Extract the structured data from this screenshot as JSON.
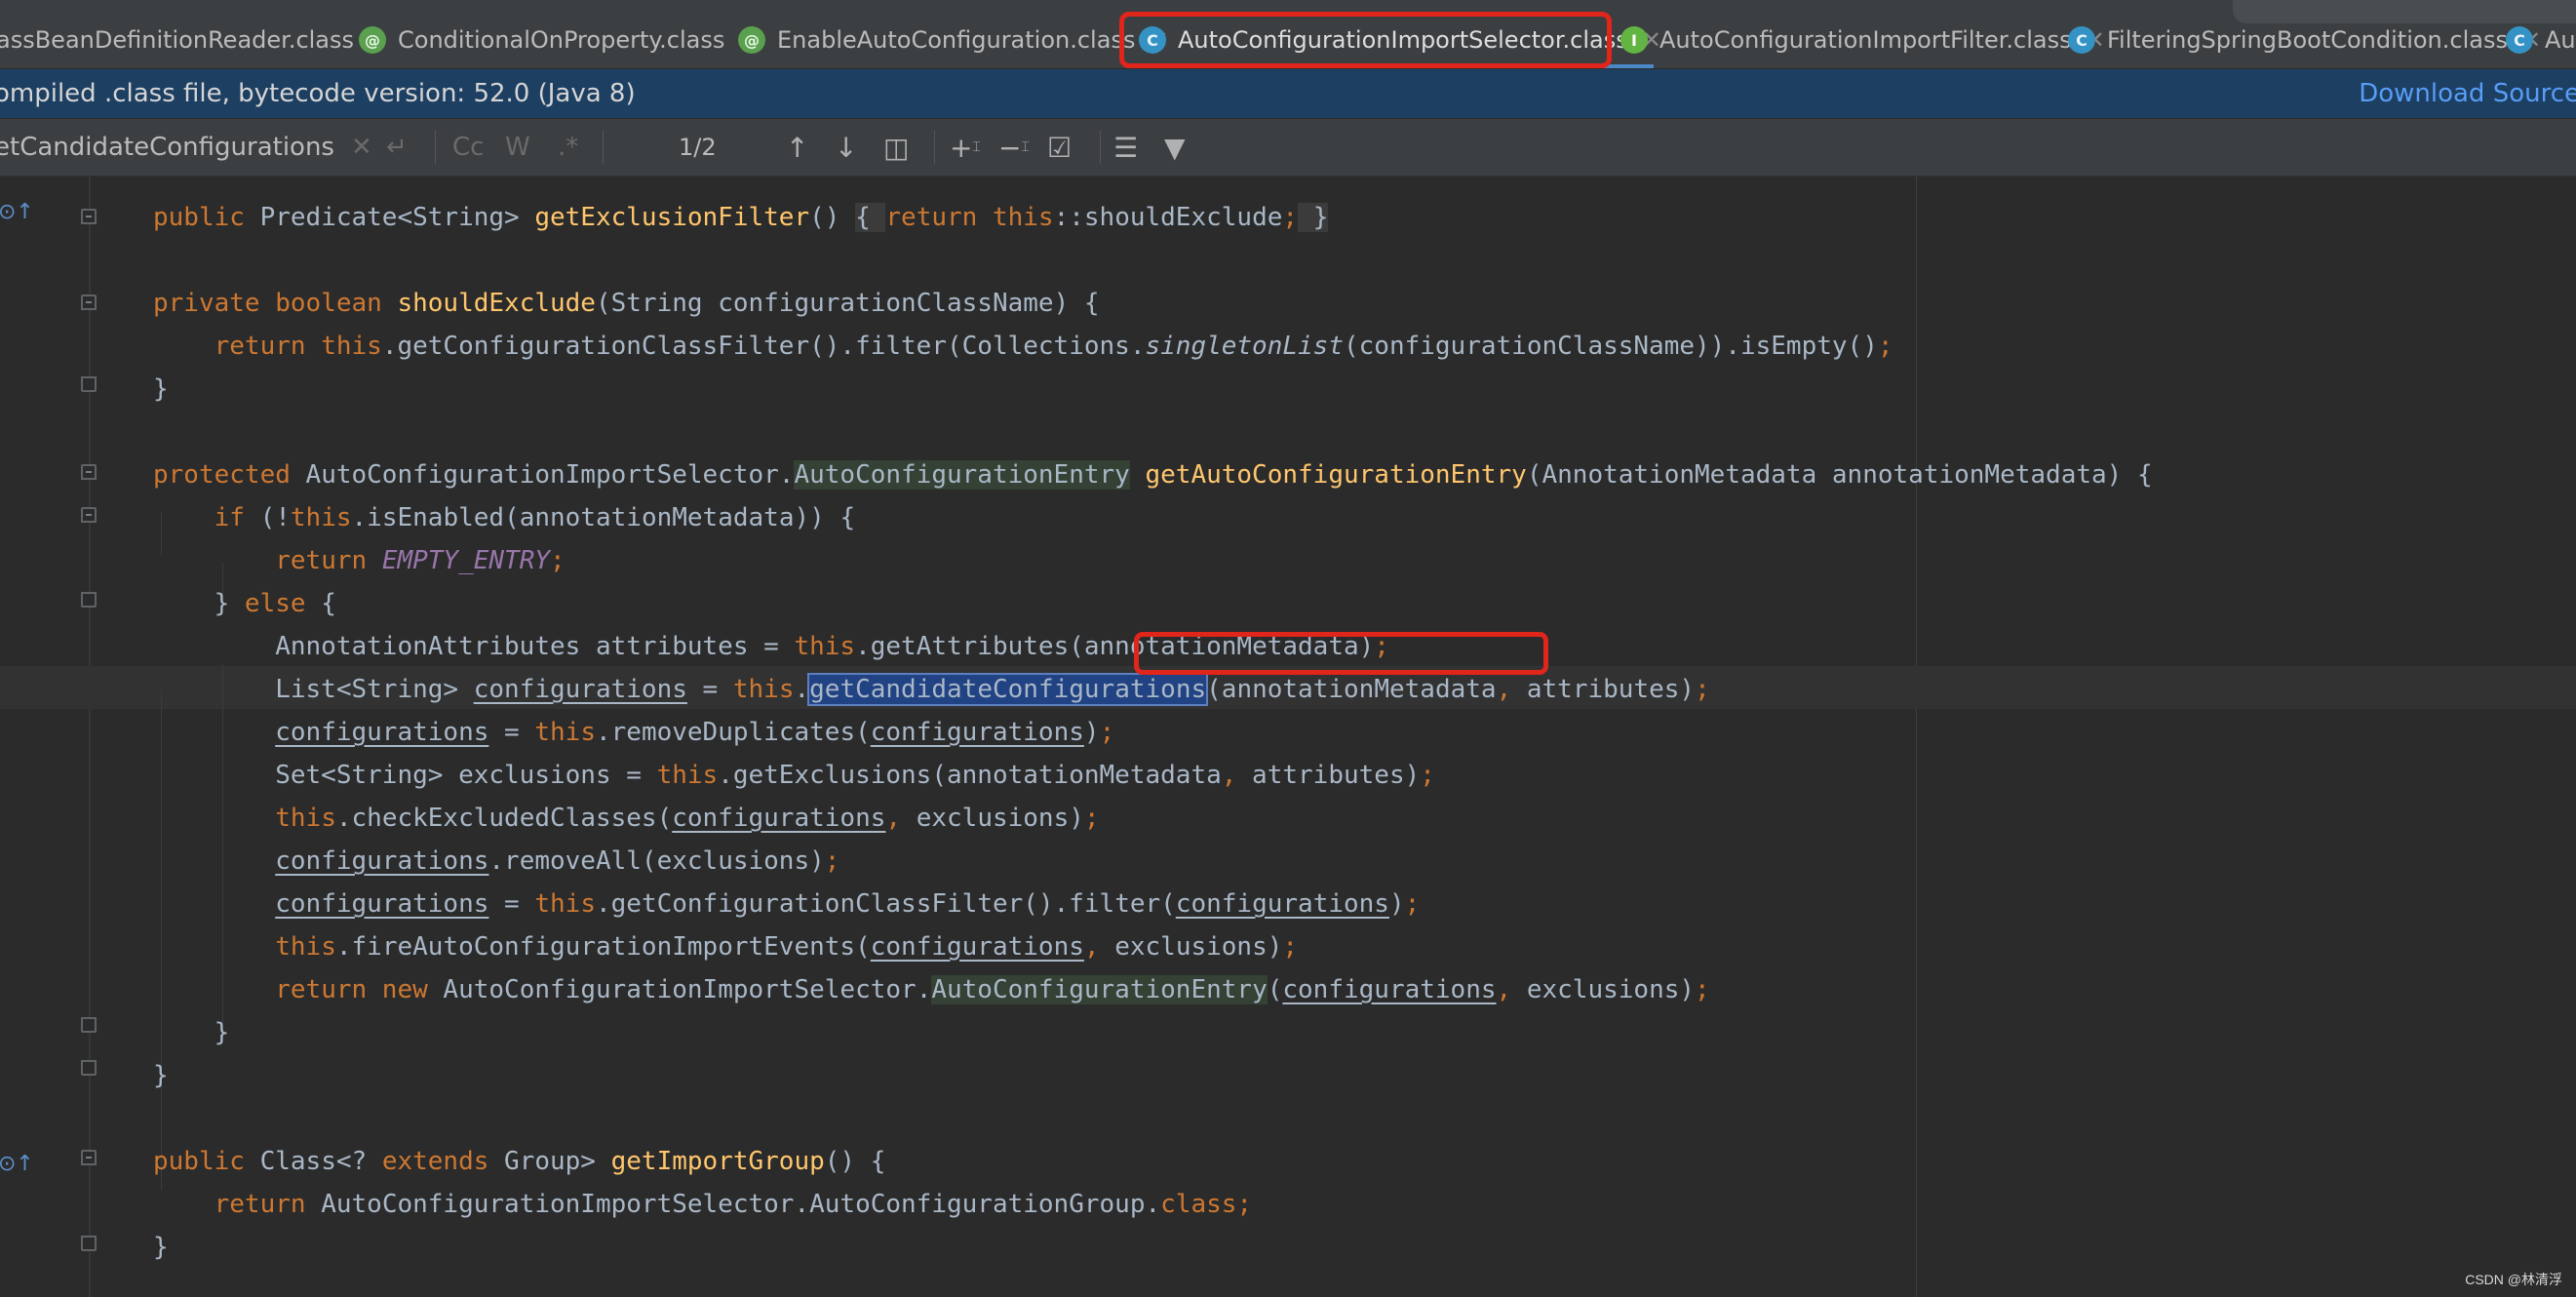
{
  "tabs": [
    {
      "label": "assBeanDefinitionReader.class",
      "icon": "class-icon",
      "active": false
    },
    {
      "label": "ConditionalOnProperty.class",
      "icon": "annotation-icon",
      "active": false
    },
    {
      "label": "EnableAutoConfiguration.class",
      "icon": "annotation-icon",
      "active": false
    },
    {
      "label": "AutoConfigurationImportSelector.class",
      "icon": "class-icon",
      "active": true
    },
    {
      "label": "AutoConfigurationImportFilter.class",
      "icon": "interface-icon",
      "active": false
    },
    {
      "label": "FilteringSpringBootCondition.class",
      "icon": "class-icon",
      "active": false
    },
    {
      "label": "Au",
      "icon": "class-icon",
      "active": false
    }
  ],
  "infobar": {
    "message": "ompiled .class file, bytecode version: 52.0 (Java 8)",
    "download_label": "Download Source"
  },
  "find": {
    "query": "etCandidateConfigurations",
    "match_case_label": "Cc",
    "words_label": "W",
    "regex_label": ".*",
    "match_count": "1/2"
  },
  "watermark": "CSDN @林清浮",
  "colors": {
    "highlight_box": "#e0251b",
    "keyword": "#cc7832",
    "method": "#ffc66d",
    "constant": "#9876aa",
    "selection": "#214283"
  }
}
